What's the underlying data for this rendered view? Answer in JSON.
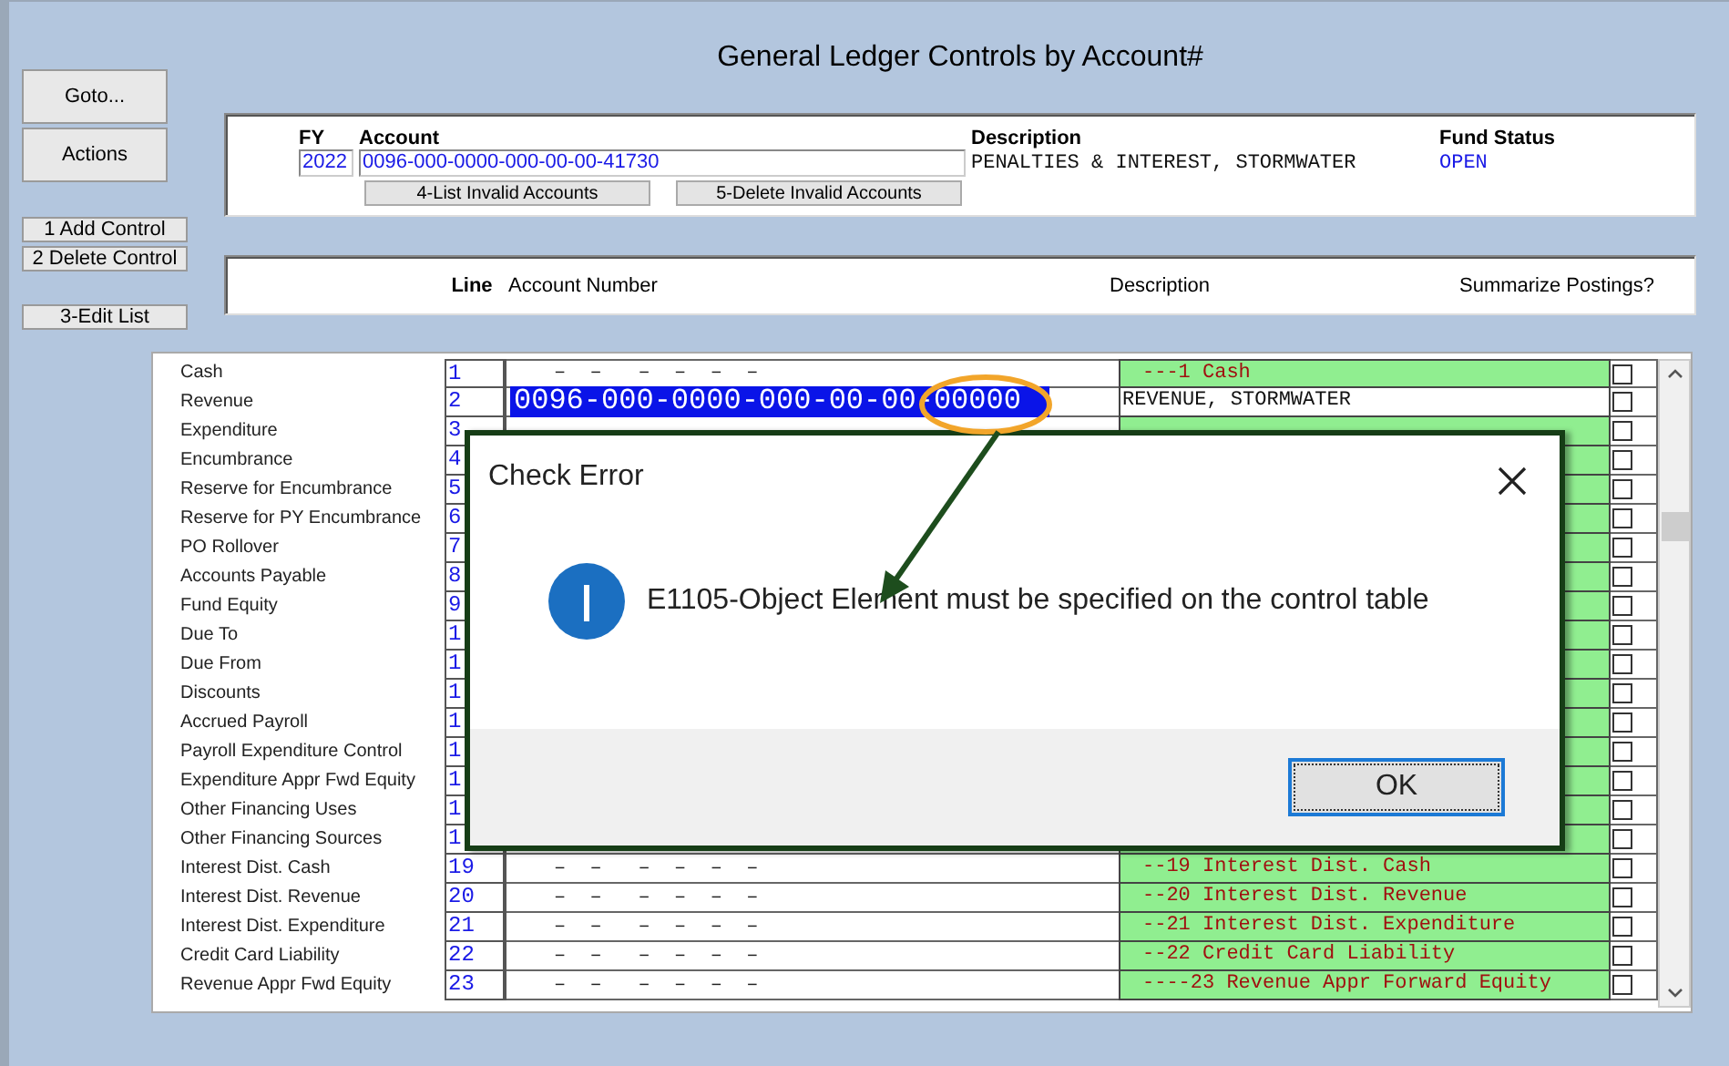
{
  "window": {
    "title": "General Ledger Controls by Account#"
  },
  "side_buttons": [
    {
      "label": "Goto...",
      "kind": "large"
    },
    {
      "label": "Actions",
      "kind": "large"
    },
    {
      "label": "1 Add Control",
      "kind": "small"
    },
    {
      "label": "2 Delete Control",
      "kind": "small"
    },
    {
      "label": "3-Edit List",
      "kind": "small"
    }
  ],
  "header": {
    "fy_label": "FY",
    "fy": "2022",
    "account_label": "Account",
    "account": "0096-000-0000-000-00-00-41730",
    "description_label": "Description",
    "description": "PENALTIES & INTEREST, STORMWATER",
    "fund_status_label": "Fund Status",
    "fund_status": "OPEN",
    "buttons": [
      "4-List Invalid Accounts",
      "5-Delete Invalid Accounts"
    ]
  },
  "columns": [
    "Line",
    "Account Number",
    "Description",
    "Summarize Postings?"
  ],
  "rows": [
    {
      "label": "Cash",
      "line": "1",
      "account": "–  –   –  –  –  –",
      "description": "---1 Cash",
      "kind": "default",
      "summarize": false
    },
    {
      "label": "Revenue",
      "line": "2",
      "account": "0096-000-0000-000-00-00-00000",
      "description": "REVENUE, STORMWATER",
      "kind": "edited",
      "summarize": false
    },
    {
      "label": "Expenditure",
      "line": "3",
      "kind": "default",
      "summarize": false
    },
    {
      "label": "Encumbrance",
      "line": "4",
      "kind": "default",
      "summarize": false
    },
    {
      "label": "Reserve for Encumbrance",
      "line": "5",
      "kind": "default",
      "summarize": false
    },
    {
      "label": "Reserve for PY Encumbrance",
      "line": "6",
      "kind": "default",
      "summarize": false
    },
    {
      "label": "PO Rollover",
      "line": "7",
      "kind": "default",
      "summarize": false
    },
    {
      "label": "Accounts Payable",
      "line": "8",
      "kind": "default",
      "summarize": false
    },
    {
      "label": "Fund Equity",
      "line": "9",
      "kind": "default",
      "summarize": false
    },
    {
      "label": "Due To",
      "line": "1",
      "kind": "default",
      "summarize": false
    },
    {
      "label": "Due From",
      "line": "1",
      "kind": "default",
      "summarize": false
    },
    {
      "label": "Discounts",
      "line": "1",
      "kind": "default",
      "summarize": false
    },
    {
      "label": "Accrued Payroll",
      "line": "1",
      "kind": "default",
      "summarize": false
    },
    {
      "label": "Payroll Expenditure Control",
      "line": "1",
      "kind": "default",
      "summarize": false
    },
    {
      "label": "Expenditure Appr Fwd Equity",
      "line": "1",
      "kind": "default",
      "summarize": false
    },
    {
      "label": "Other Financing Uses",
      "line": "1",
      "kind": "default",
      "summarize": false
    },
    {
      "label": "Other Financing Sources",
      "line": "1",
      "kind": "default",
      "summarize": false
    },
    {
      "label": "Interest Dist. Cash",
      "line": "19",
      "account": "–  –   –  –  –  –",
      "description": "--19 Interest Dist. Cash",
      "kind": "default",
      "summarize": false
    },
    {
      "label": "Interest Dist. Revenue",
      "line": "20",
      "account": "–  –   –  –  –  –",
      "description": "--20 Interest Dist. Revenue",
      "kind": "default",
      "summarize": false
    },
    {
      "label": "Interest Dist. Expenditure",
      "line": "21",
      "account": "–  –   –  –  –  –",
      "description": "--21 Interest Dist. Expenditure",
      "kind": "default",
      "summarize": false
    },
    {
      "label": "Credit Card Liability",
      "line": "22",
      "account": "–  –   –  –  –  –",
      "description": "--22 Credit Card Liability",
      "kind": "default",
      "summarize": false
    },
    {
      "label": "Revenue Appr Fwd Equity",
      "line": "23",
      "account": "–  –   –  –  –  –",
      "description": "----23 Revenue Appr Forward Equity",
      "kind": "default",
      "summarize": false
    }
  ],
  "dialog": {
    "title": "Check Error",
    "message": "E1105-Object Element must be specified on the control table",
    "button": "OK"
  }
}
